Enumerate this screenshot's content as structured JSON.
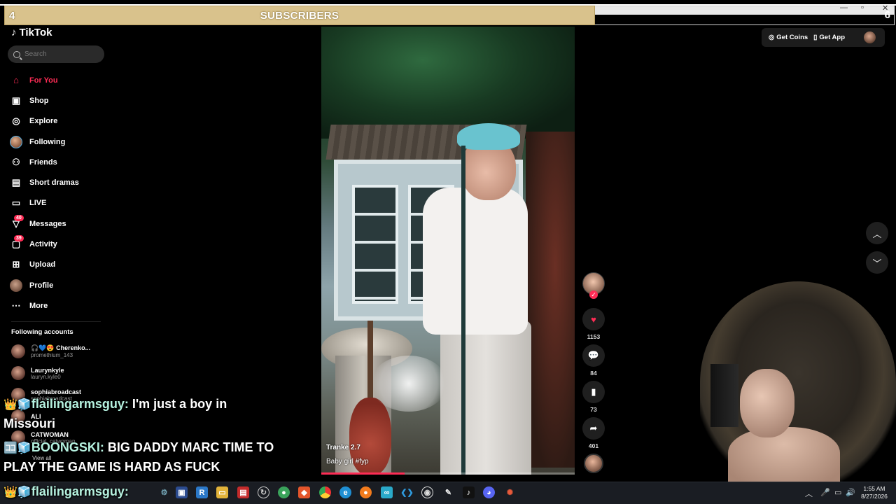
{
  "overlay": {
    "banner_label": "SUBSCRIBERS",
    "left_number": "4",
    "right_number": "6"
  },
  "tiktok": {
    "logo_text": "TikTok",
    "search_placeholder": "Search",
    "nav": [
      {
        "label": "For You",
        "icon": "home-icon",
        "active": true
      },
      {
        "label": "Shop",
        "icon": "shop-bag-icon"
      },
      {
        "label": "Explore",
        "icon": "compass-icon"
      },
      {
        "label": "Following",
        "icon": "following-avatar-icon"
      },
      {
        "label": "Friends",
        "icon": "friends-icon"
      },
      {
        "label": "Short dramas",
        "icon": "film-icon"
      },
      {
        "label": "LIVE",
        "icon": "live-icon"
      },
      {
        "label": "Messages",
        "icon": "messages-icon",
        "badge": "40"
      },
      {
        "label": "Activity",
        "icon": "activity-icon",
        "badge": "39"
      },
      {
        "label": "Upload",
        "icon": "upload-icon"
      },
      {
        "label": "Profile",
        "icon": "profile-avatar-icon"
      },
      {
        "label": "More",
        "icon": "more-dots-icon"
      }
    ],
    "following_header": "Following accounts",
    "accounts": [
      {
        "name": "Cherenko...",
        "username": "promethium_143"
      },
      {
        "name": "Laurynkyle",
        "username": "lauryn.kyle0"
      },
      {
        "name": "sophiabroadcast",
        "username": "sophiabroadcast"
      },
      {
        "name": "ALI",
        "username": ""
      },
      {
        "name": "CATWOMAN",
        "username": "official_catwoman"
      }
    ],
    "view_all": "View all",
    "header": {
      "get_coins": "Get Coins",
      "get_app": "Get App"
    },
    "video": {
      "author": "Tranke 2.7",
      "caption": "Baby girl #fyp",
      "progress": 0.33
    },
    "actions": {
      "likes": "1153",
      "comments": "84",
      "saves": "73",
      "shares": "401"
    }
  },
  "chat": [
    {
      "user": "flailingarmsguy:",
      "message": "I'm just a boy in Missouri"
    },
    {
      "user": "BOONGSKI:",
      "message": "BIG DADDY MARC TIME TO PLAY THE GAME IS HARD AS FUCK"
    },
    {
      "user": "flailingarmsguy:",
      "message": ""
    }
  ],
  "taskbar": {
    "clock_time": "1:55 AM",
    "clock_date": "8/27/2026"
  },
  "colors": {
    "accent": "#fe2c55",
    "banner": "#d9c28c",
    "taskbar": "#1a1d23"
  }
}
